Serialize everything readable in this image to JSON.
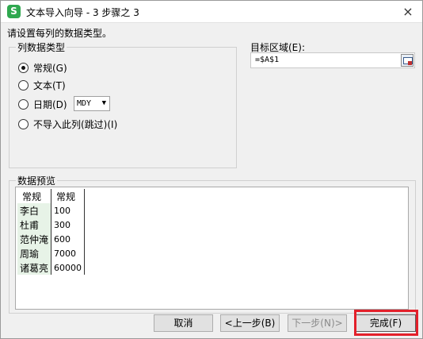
{
  "window": {
    "app_icon": "S",
    "title": "文本导入向导 - 3 步骤之 3",
    "close": "×"
  },
  "prompt": "请设置每列的数据类型。",
  "column_type": {
    "legend": "列数据类型",
    "options": [
      {
        "label": "常规(G)",
        "checked": true
      },
      {
        "label": "文本(T)",
        "checked": false
      },
      {
        "label": "日期(D)",
        "checked": false
      },
      {
        "label": "不导入此列(跳过)(I)",
        "checked": false
      }
    ],
    "date_format": "MDY"
  },
  "target": {
    "label": "目标区域(E):",
    "value": "=$A$1"
  },
  "preview": {
    "legend": "数据预览",
    "headers": [
      "常规",
      "常规"
    ],
    "rows": [
      [
        "李白",
        "100"
      ],
      [
        "杜甫",
        "300"
      ],
      [
        "范仲淹",
        "600"
      ],
      [
        "周瑜",
        "7000"
      ],
      [
        "诸葛亮",
        "60000"
      ]
    ]
  },
  "buttons": {
    "cancel": "取消",
    "back": "<上一步(B)",
    "next": "下一步(N)>",
    "finish": "完成(F)"
  },
  "colors": {
    "highlight": "#e3202a",
    "app_icon": "#2fa84f",
    "first_column": "#e7f3e7"
  }
}
